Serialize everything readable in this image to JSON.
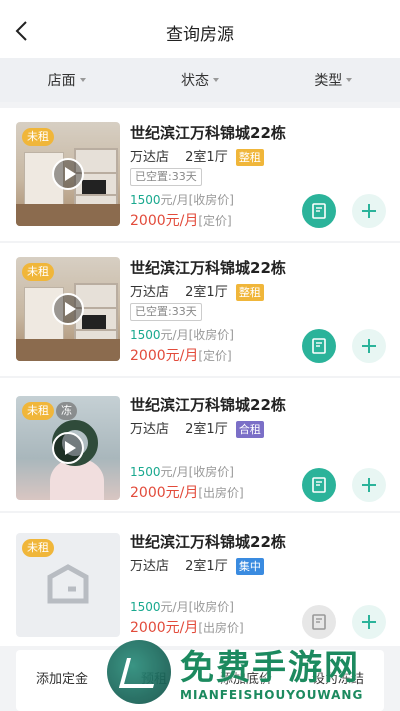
{
  "header": {
    "title": "查询房源"
  },
  "filters": [
    {
      "label": "店面"
    },
    {
      "label": "状态"
    },
    {
      "label": "类型"
    }
  ],
  "listings": [
    {
      "status_badge": "未租",
      "name": "世纪滨江万科锦城22栋",
      "store": "万达店",
      "layout": "2室1厅",
      "rental_type": "整租",
      "rental_type_color": "#f0b63a",
      "vacancy": "已空置:33天",
      "collect_price": "1500",
      "collect_unit": "元/月[收房价]",
      "rent_price": "2000",
      "rent_unit_mid": "元/月",
      "rent_unit_tail": "[定价]"
    },
    {
      "status_badge": "未租",
      "name": "世纪滨江万科锦城22栋",
      "store": "万达店",
      "layout": "2室1厅",
      "rental_type": "整租",
      "rental_type_color": "#f0b63a",
      "vacancy": "已空置:33天",
      "collect_price": "1500",
      "collect_unit": "元/月[收房价]",
      "rent_price": "2000",
      "rent_unit_mid": "元/月",
      "rent_unit_tail": "[定价]"
    },
    {
      "status_badge": "未租",
      "frozen_badge": "冻",
      "name": "世纪滨江万科锦城22栋",
      "store": "万达店",
      "layout": "2室1厅",
      "rental_type": "合租",
      "rental_type_color": "#7b6fc7",
      "collect_price": "1500",
      "collect_unit": "元/月[收房价]",
      "rent_price": "2000",
      "rent_unit_mid": "元/月",
      "rent_unit_tail": "[出房价]"
    },
    {
      "status_badge": "未租",
      "name": "世纪滨江万科锦城22栋",
      "store": "万达店",
      "layout": "2室1厅",
      "rental_type": "集中",
      "rental_type_color": "#3a8be0",
      "collect_price": "1500",
      "collect_unit": "元/月[收房价]",
      "rent_price": "2000",
      "rent_unit_mid": "元/月",
      "rent_unit_tail": "[出房价]"
    }
  ],
  "bottom_actions": [
    {
      "label": "添加定金"
    },
    {
      "label": "预租"
    },
    {
      "label": "添加底价"
    },
    {
      "label": "设为冻结"
    }
  ],
  "watermark": {
    "title": "免费手游网",
    "subtitle": "MIANFEISHOUYOUWANG"
  },
  "colors": {
    "accent": "#2bb39a",
    "price_red": "#e24b3b",
    "price_green": "#1aa98f",
    "badge_unrented": "#f0b63a"
  }
}
